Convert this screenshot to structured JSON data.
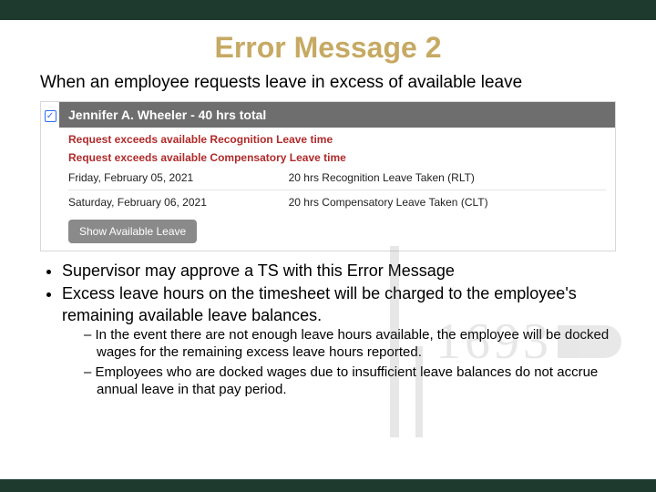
{
  "title": "Error Message 2",
  "intro": "When an employee requests leave in excess of available leave",
  "mockup": {
    "checkbox_checked": "✓",
    "header": "Jennifer A. Wheeler - 40 hrs total",
    "errors": [
      "Request exceeds available Recognition Leave time",
      "Request exceeds available Compensatory Leave time"
    ],
    "rows": [
      {
        "date": "Friday, February 05, 2021",
        "detail": "20 hrs Recognition Leave Taken (RLT)"
      },
      {
        "date": "Saturday, February 06, 2021",
        "detail": "20 hrs Compensatory Leave Taken (CLT)"
      }
    ],
    "show_btn": "Show Available Leave"
  },
  "bullets": {
    "b1": "Supervisor may approve a TS with this Error Message",
    "b2": "Excess leave hours on the timesheet will be charged to the employee's remaining available leave balances.",
    "s1": "In the event there are not enough leave hours available, the employee will be docked wages for the remaining excess leave hours reported.",
    "s2": "Employees who are docked wages due to insufficient leave balances do not accrue annual leave in that pay period."
  },
  "watermark": {
    "text": "1693"
  }
}
